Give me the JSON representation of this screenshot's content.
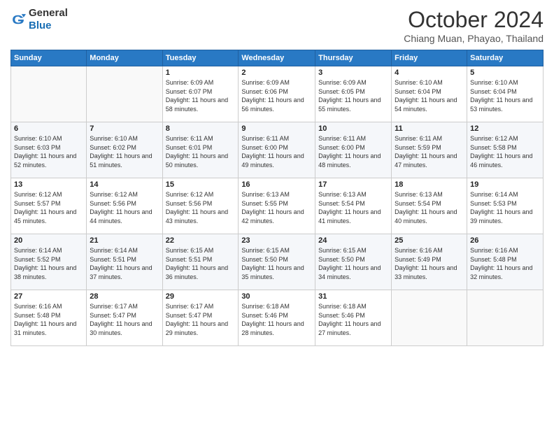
{
  "header": {
    "logo_line1": "General",
    "logo_line2": "Blue",
    "month_title": "October 2024",
    "subtitle": "Chiang Muan, Phayao, Thailand"
  },
  "weekdays": [
    "Sunday",
    "Monday",
    "Tuesday",
    "Wednesday",
    "Thursday",
    "Friday",
    "Saturday"
  ],
  "weeks": [
    [
      {
        "day": "",
        "info": ""
      },
      {
        "day": "",
        "info": ""
      },
      {
        "day": "1",
        "info": "Sunrise: 6:09 AM\nSunset: 6:07 PM\nDaylight: 11 hours and 58 minutes."
      },
      {
        "day": "2",
        "info": "Sunrise: 6:09 AM\nSunset: 6:06 PM\nDaylight: 11 hours and 56 minutes."
      },
      {
        "day": "3",
        "info": "Sunrise: 6:09 AM\nSunset: 6:05 PM\nDaylight: 11 hours and 55 minutes."
      },
      {
        "day": "4",
        "info": "Sunrise: 6:10 AM\nSunset: 6:04 PM\nDaylight: 11 hours and 54 minutes."
      },
      {
        "day": "5",
        "info": "Sunrise: 6:10 AM\nSunset: 6:04 PM\nDaylight: 11 hours and 53 minutes."
      }
    ],
    [
      {
        "day": "6",
        "info": "Sunrise: 6:10 AM\nSunset: 6:03 PM\nDaylight: 11 hours and 52 minutes."
      },
      {
        "day": "7",
        "info": "Sunrise: 6:10 AM\nSunset: 6:02 PM\nDaylight: 11 hours and 51 minutes."
      },
      {
        "day": "8",
        "info": "Sunrise: 6:11 AM\nSunset: 6:01 PM\nDaylight: 11 hours and 50 minutes."
      },
      {
        "day": "9",
        "info": "Sunrise: 6:11 AM\nSunset: 6:00 PM\nDaylight: 11 hours and 49 minutes."
      },
      {
        "day": "10",
        "info": "Sunrise: 6:11 AM\nSunset: 6:00 PM\nDaylight: 11 hours and 48 minutes."
      },
      {
        "day": "11",
        "info": "Sunrise: 6:11 AM\nSunset: 5:59 PM\nDaylight: 11 hours and 47 minutes."
      },
      {
        "day": "12",
        "info": "Sunrise: 6:12 AM\nSunset: 5:58 PM\nDaylight: 11 hours and 46 minutes."
      }
    ],
    [
      {
        "day": "13",
        "info": "Sunrise: 6:12 AM\nSunset: 5:57 PM\nDaylight: 11 hours and 45 minutes."
      },
      {
        "day": "14",
        "info": "Sunrise: 6:12 AM\nSunset: 5:56 PM\nDaylight: 11 hours and 44 minutes."
      },
      {
        "day": "15",
        "info": "Sunrise: 6:12 AM\nSunset: 5:56 PM\nDaylight: 11 hours and 43 minutes."
      },
      {
        "day": "16",
        "info": "Sunrise: 6:13 AM\nSunset: 5:55 PM\nDaylight: 11 hours and 42 minutes."
      },
      {
        "day": "17",
        "info": "Sunrise: 6:13 AM\nSunset: 5:54 PM\nDaylight: 11 hours and 41 minutes."
      },
      {
        "day": "18",
        "info": "Sunrise: 6:13 AM\nSunset: 5:54 PM\nDaylight: 11 hours and 40 minutes."
      },
      {
        "day": "19",
        "info": "Sunrise: 6:14 AM\nSunset: 5:53 PM\nDaylight: 11 hours and 39 minutes."
      }
    ],
    [
      {
        "day": "20",
        "info": "Sunrise: 6:14 AM\nSunset: 5:52 PM\nDaylight: 11 hours and 38 minutes."
      },
      {
        "day": "21",
        "info": "Sunrise: 6:14 AM\nSunset: 5:51 PM\nDaylight: 11 hours and 37 minutes."
      },
      {
        "day": "22",
        "info": "Sunrise: 6:15 AM\nSunset: 5:51 PM\nDaylight: 11 hours and 36 minutes."
      },
      {
        "day": "23",
        "info": "Sunrise: 6:15 AM\nSunset: 5:50 PM\nDaylight: 11 hours and 35 minutes."
      },
      {
        "day": "24",
        "info": "Sunrise: 6:15 AM\nSunset: 5:50 PM\nDaylight: 11 hours and 34 minutes."
      },
      {
        "day": "25",
        "info": "Sunrise: 6:16 AM\nSunset: 5:49 PM\nDaylight: 11 hours and 33 minutes."
      },
      {
        "day": "26",
        "info": "Sunrise: 6:16 AM\nSunset: 5:48 PM\nDaylight: 11 hours and 32 minutes."
      }
    ],
    [
      {
        "day": "27",
        "info": "Sunrise: 6:16 AM\nSunset: 5:48 PM\nDaylight: 11 hours and 31 minutes."
      },
      {
        "day": "28",
        "info": "Sunrise: 6:17 AM\nSunset: 5:47 PM\nDaylight: 11 hours and 30 minutes."
      },
      {
        "day": "29",
        "info": "Sunrise: 6:17 AM\nSunset: 5:47 PM\nDaylight: 11 hours and 29 minutes."
      },
      {
        "day": "30",
        "info": "Sunrise: 6:18 AM\nSunset: 5:46 PM\nDaylight: 11 hours and 28 minutes."
      },
      {
        "day": "31",
        "info": "Sunrise: 6:18 AM\nSunset: 5:46 PM\nDaylight: 11 hours and 27 minutes."
      },
      {
        "day": "",
        "info": ""
      },
      {
        "day": "",
        "info": ""
      }
    ]
  ]
}
